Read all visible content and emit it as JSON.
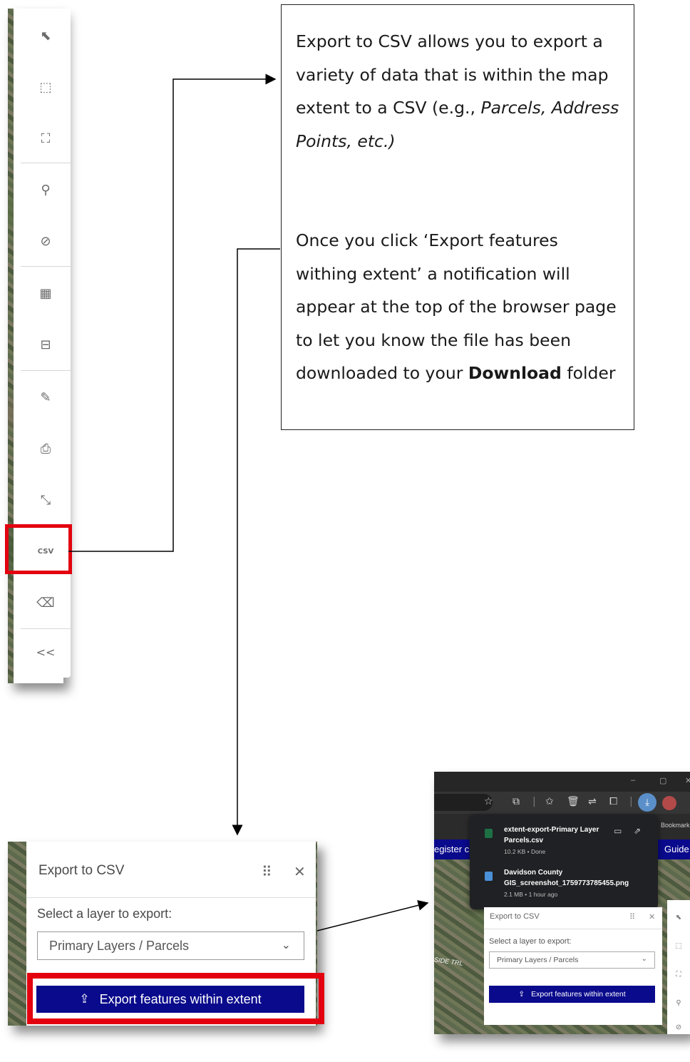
{
  "toolbar": {
    "tools": [
      {
        "name": "select-icon",
        "glyph": "⬉"
      },
      {
        "name": "select-by-rectangle-icon",
        "glyph": "⬚"
      },
      {
        "name": "zoom-to-extent-icon",
        "glyph": "⛶"
      },
      {
        "name": "location-pin-icon",
        "glyph": "⚲"
      },
      {
        "name": "compass-icon",
        "glyph": "⊘"
      },
      {
        "name": "measure-area-icon",
        "glyph": "▦"
      },
      {
        "name": "measure-distance-icon",
        "glyph": "⊟"
      },
      {
        "name": "draw-sketch-icon",
        "glyph": "✎"
      },
      {
        "name": "print-icon",
        "glyph": "⎙"
      },
      {
        "name": "collapse-extent-icon",
        "glyph": "⤡"
      },
      {
        "name": "export-csv-icon",
        "glyph": "CSV"
      },
      {
        "name": "eraser-icon",
        "glyph": "⌫"
      },
      {
        "name": "collapse-toolbar-icon",
        "glyph": "<<"
      }
    ]
  },
  "callout": {
    "para1_plain": "Export to CSV allows you to export a variety of data that is within the map extent to a CSV (e.g., ",
    "para1_italic": "Parcels, Address Points, etc.)",
    "para2_plain": "Once you click ‘Export features withing extent’ a notification will appear at the top of the browser page to let you know the file has been downloaded to your ",
    "para2_bold": "Download",
    "para2_tail": " folder"
  },
  "export_panel": {
    "title": "Export to CSV",
    "drag_glyph": "⠿",
    "close_glyph": "✕",
    "select_label": "Select a layer to export:",
    "selected_layer": "Primary Layers / Parcels",
    "chevron": "⌄",
    "button_label": "Export features within extent",
    "button_icon": "⇪"
  },
  "browser": {
    "window_controls": [
      "–",
      "▢",
      "✕"
    ],
    "toolbar_icons": [
      "☆",
      "⧉",
      "|",
      "✩",
      "🗑",
      "⇌",
      "⧠",
      "|"
    ],
    "bookmarks_label": "Bookmark",
    "nav_left": "egister c",
    "nav_right": "Guide",
    "road_label": "SIDE TRL",
    "downloads": [
      {
        "name": "extent-export-Primary Layer Parcels.csv",
        "meta": "10.2 KB • Done",
        "color": "#1d7044"
      },
      {
        "name": "Davidson County GIS_screenshot_1759773785455.png",
        "meta": "2.1 MB • 1 hour ago",
        "color": "#4a90d9"
      }
    ],
    "mini_panel": {
      "title": "Export to CSV",
      "select_label": "Select a layer to export:",
      "selected_layer": "Primary Layers / Parcels",
      "button_label": "Export features within extent"
    },
    "mini_tools": [
      "⬉",
      "⬚",
      "⛶",
      "⚲",
      "⊘"
    ]
  },
  "colors": {
    "highlight": "#e3000f",
    "button_blue": "#0a0a8c",
    "download_badge": "#5a8fc9"
  }
}
